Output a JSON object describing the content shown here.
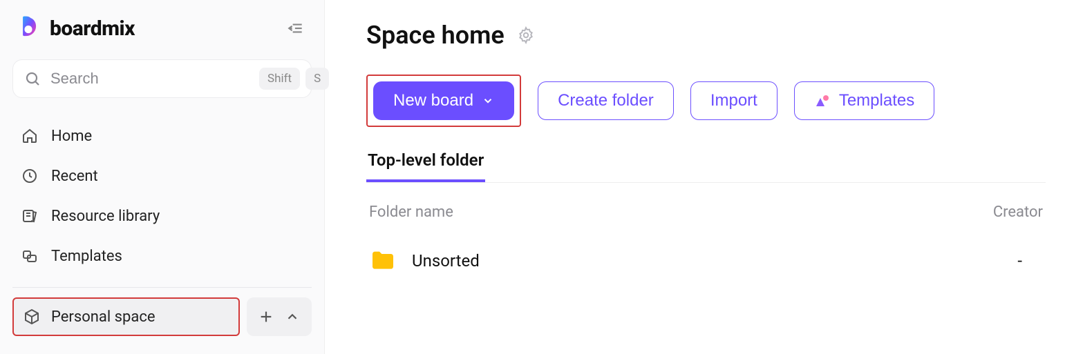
{
  "brand": {
    "name": "boardmix"
  },
  "search": {
    "placeholder": "Search",
    "shortcut1": "Shift",
    "shortcut2": "S"
  },
  "nav": {
    "home": "Home",
    "recent": "Recent",
    "resource_library": "Resource library",
    "templates": "Templates"
  },
  "space": {
    "label": "Personal space"
  },
  "page": {
    "title": "Space home"
  },
  "actions": {
    "new_board": "New board",
    "create_folder": "Create folder",
    "import": "Import",
    "templates": "Templates"
  },
  "tabs": {
    "top_level_folder": "Top-level folder"
  },
  "table": {
    "col_folder": "Folder name",
    "col_creator": "Creator",
    "rows": [
      {
        "name": "Unsorted",
        "creator": "-"
      }
    ]
  }
}
